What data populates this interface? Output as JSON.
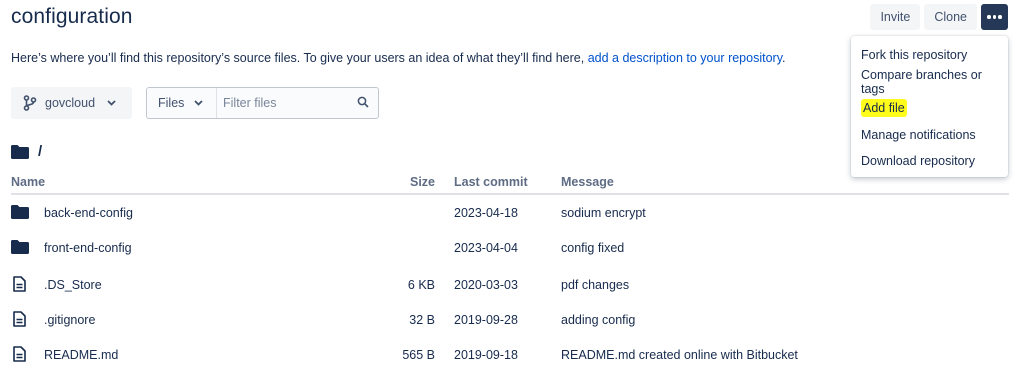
{
  "header": {
    "title": "configuration"
  },
  "actions": {
    "invite": "Invite",
    "clone": "Clone",
    "more_icon": "more-dots-icon"
  },
  "description": {
    "text": "Here’s where you’ll find this repository’s source files. To give your users an idea of what they’ll find here,",
    "link": "add a description to your repository",
    "end": "."
  },
  "branch": {
    "name": "govcloud",
    "icon": "branch-icon"
  },
  "filter": {
    "scope": "Files",
    "placeholder": "Filter files"
  },
  "path": {
    "current": "/"
  },
  "table": {
    "columns": {
      "name": "Name",
      "size": "Size",
      "last_commit": "Last commit",
      "message": "Message"
    },
    "rows": [
      {
        "type": "folder",
        "name": "back-end-config",
        "size": "",
        "date": "2023-04-18",
        "message": "sodium encrypt"
      },
      {
        "type": "folder",
        "name": "front-end-config",
        "size": "",
        "date": "2023-04-04",
        "message": "config fixed"
      },
      {
        "type": "file",
        "name": ".DS_Store",
        "size": "6 KB",
        "date": "2020-03-03",
        "message": "pdf changes"
      },
      {
        "type": "file",
        "name": ".gitignore",
        "size": "32 B",
        "date": "2019-09-28",
        "message": "adding config"
      },
      {
        "type": "file",
        "name": "README.md",
        "size": "565 B",
        "date": "2019-09-18",
        "message": "README.md created online with Bitbucket"
      }
    ]
  },
  "menu": {
    "items": [
      "Fork this repository",
      "Compare branches or tags",
      "Add file",
      "Manage notifications",
      "Download repository"
    ],
    "highlighted": "Add file"
  },
  "colors": {
    "text": "#172b4d",
    "link": "#0052cc",
    "muted": "#5e6c84",
    "highlight": "#fffb1a",
    "more_button": "#253858"
  }
}
